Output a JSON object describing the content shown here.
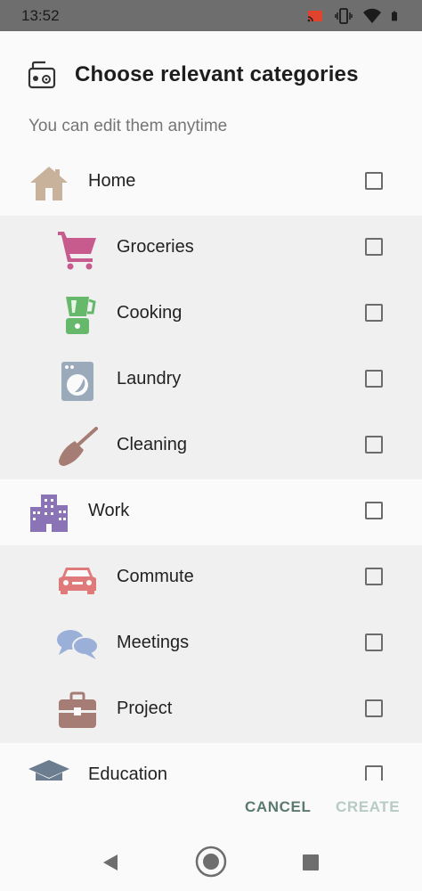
{
  "status": {
    "time": "13:52",
    "icons": [
      "cast-icon",
      "vibrate-icon",
      "wifi-icon",
      "battery-icon"
    ]
  },
  "dialog": {
    "title": "Choose relevant categories",
    "subtitle": "You can edit them anytime",
    "header_icon": "radio-icon",
    "cancel_label": "CANCEL",
    "create_label": "CREATE"
  },
  "categories": [
    {
      "label": "Home",
      "level": "parent",
      "checked": false,
      "icon": "home-icon",
      "color": "#c9b29c"
    },
    {
      "label": "Groceries",
      "level": "sub",
      "checked": false,
      "icon": "cart-icon",
      "color": "#c75b8e"
    },
    {
      "label": "Cooking",
      "level": "sub",
      "checked": false,
      "icon": "blender-icon",
      "color": "#66b86a"
    },
    {
      "label": "Laundry",
      "level": "sub",
      "checked": false,
      "icon": "washing-machine-icon",
      "color": "#9aaabb"
    },
    {
      "label": "Cleaning",
      "level": "sub",
      "checked": false,
      "icon": "broom-icon",
      "color": "#a57d74"
    },
    {
      "label": "Work",
      "level": "parent",
      "checked": false,
      "icon": "building-icon",
      "color": "#8a74b6"
    },
    {
      "label": "Commute",
      "level": "sub",
      "checked": false,
      "icon": "car-icon",
      "color": "#e07a7a"
    },
    {
      "label": "Meetings",
      "level": "sub",
      "checked": false,
      "icon": "chat-bubbles-icon",
      "color": "#9ab0d8"
    },
    {
      "label": "Project",
      "level": "sub",
      "checked": false,
      "icon": "briefcase-icon",
      "color": "#a57d74"
    },
    {
      "label": "Education",
      "level": "parent",
      "checked": false,
      "icon": "graduation-cap-icon",
      "color": "#6b7d8e"
    }
  ],
  "navigation": [
    "back-icon",
    "home-nav-icon",
    "recents-icon"
  ]
}
